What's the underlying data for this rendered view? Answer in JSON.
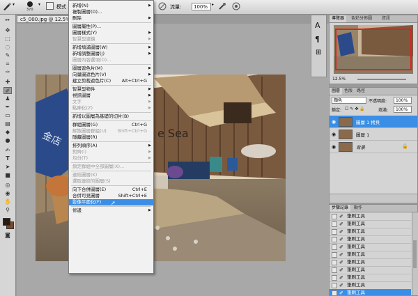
{
  "options_bar": {
    "brush_size": "370",
    "mode_label": "模式",
    "flow_label": "流量:",
    "flow_value": "100%"
  },
  "document": {
    "tab_title": "c5_000.jpg @ 12.5% (..."
  },
  "menu": {
    "items": [
      {
        "label": "新增(N)",
        "shortcut": "",
        "submenu": true,
        "disabled": false
      },
      {
        "label": "複製圖層(D)...",
        "shortcut": "",
        "submenu": false,
        "disabled": false
      },
      {
        "label": "刪除",
        "shortcut": "",
        "submenu": true,
        "disabled": false
      },
      {
        "label": "圖層屬性(P)...",
        "shortcut": "",
        "submenu": false,
        "disabled": false
      },
      {
        "label": "圖層樣式(Y)",
        "shortcut": "",
        "submenu": true,
        "disabled": false
      },
      {
        "label": "智慧型濾鏡",
        "shortcut": "",
        "submenu": true,
        "disabled": true
      },
      {
        "label": "新增填滿圖層(W)",
        "shortcut": "",
        "submenu": true,
        "disabled": false
      },
      {
        "label": "新增調整圖層(J)",
        "shortcut": "",
        "submenu": true,
        "disabled": false
      },
      {
        "label": "圖層內容選項(O)...",
        "shortcut": "",
        "submenu": false,
        "disabled": true
      },
      {
        "label": "圖層遮色片(M)",
        "shortcut": "",
        "submenu": true,
        "disabled": false
      },
      {
        "label": "向量圖遮色片(V)",
        "shortcut": "",
        "submenu": true,
        "disabled": false
      },
      {
        "label": "建立剪裁遮色片(C)",
        "shortcut": "Alt+Ctrl+G",
        "submenu": false,
        "disabled": false
      },
      {
        "label": "智慧型物件",
        "shortcut": "",
        "submenu": true,
        "disabled": false
      },
      {
        "label": "視訊圖層",
        "shortcut": "",
        "submenu": true,
        "disabled": false
      },
      {
        "label": "文字",
        "shortcut": "",
        "submenu": true,
        "disabled": true
      },
      {
        "label": "點陣化(Z)",
        "shortcut": "",
        "submenu": true,
        "disabled": true
      },
      {
        "label": "新增以圖層為基礎的切片(B)",
        "shortcut": "",
        "submenu": false,
        "disabled": false
      },
      {
        "label": "群組圖層(G)",
        "shortcut": "Ctrl+G",
        "submenu": false,
        "disabled": false
      },
      {
        "label": "解散圖層群組(U)",
        "shortcut": "Shift+Ctrl+G",
        "submenu": false,
        "disabled": true
      },
      {
        "label": "隱藏圖層(R)",
        "shortcut": "",
        "submenu": false,
        "disabled": false
      },
      {
        "label": "排列順序(A)",
        "shortcut": "",
        "submenu": true,
        "disabled": false
      },
      {
        "label": "對齊(I)",
        "shortcut": "",
        "submenu": true,
        "disabled": true
      },
      {
        "label": "均分(T)",
        "shortcut": "",
        "submenu": true,
        "disabled": true
      },
      {
        "label": "鎖定群組中全部圖層(X)...",
        "shortcut": "",
        "submenu": false,
        "disabled": true
      },
      {
        "label": "連結圖層(K)",
        "shortcut": "",
        "submenu": false,
        "disabled": true
      },
      {
        "label": "選取連結的圖層(S)",
        "shortcut": "",
        "submenu": false,
        "disabled": true
      },
      {
        "label": "向下合併圖層(E)",
        "shortcut": "Ctrl+E",
        "submenu": false,
        "disabled": false
      },
      {
        "label": "合併可見圖層",
        "shortcut": "Shift+Ctrl+E",
        "submenu": false,
        "disabled": false
      },
      {
        "label": "影像平面化(F)",
        "shortcut": "",
        "submenu": false,
        "disabled": false,
        "highlighted": true
      },
      {
        "label": "修邊",
        "shortcut": "",
        "submenu": true,
        "disabled": false
      }
    ]
  },
  "navigator": {
    "tabs": [
      "導覽器",
      "色彩分佈圖",
      "資訊"
    ],
    "zoom": "12.5%"
  },
  "layers_panel": {
    "tabs": [
      "圖層",
      "色版",
      "路徑"
    ],
    "blend_mode": "顏色",
    "opacity_label": "不透明度:",
    "opacity_value": "100%",
    "lock_label": "鎖定:",
    "fill_label": "填滿:",
    "fill_value": "100%",
    "layers": [
      {
        "name": "圖層 1 拷貝",
        "selected": true
      },
      {
        "name": "圖層 1",
        "selected": false
      },
      {
        "name": "背景",
        "selected": false,
        "locked": true
      }
    ]
  },
  "history_panel": {
    "tabs": [
      "步驟記錄",
      "動作"
    ],
    "items": [
      "筆刷工具",
      "筆刷工具",
      "筆刷工具",
      "筆刷工具",
      "筆刷工具",
      "筆刷工具",
      "筆刷工具",
      "筆刷工具",
      "筆刷工具",
      "筆刷工具",
      "筆刷工具"
    ]
  },
  "colors": {
    "highlight": "#3a8ee6",
    "foreground_swatch": "#2b1a0e",
    "background_swatch": "#7a4a2a"
  }
}
